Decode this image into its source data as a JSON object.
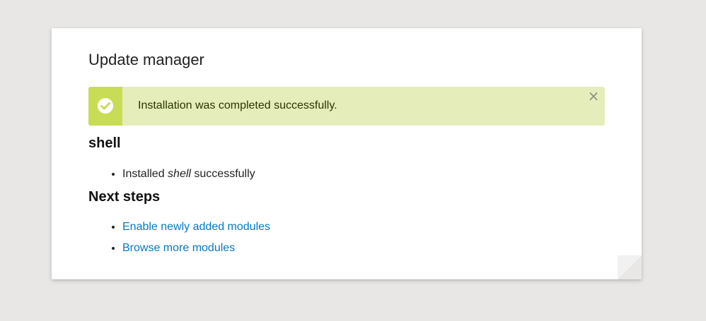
{
  "page": {
    "title": "Update manager"
  },
  "status": {
    "message": "Installation was completed successfully.",
    "dismiss_glyph": "×"
  },
  "module": {
    "name": "shell",
    "result": {
      "prefix": "Installed ",
      "name": "shell",
      "suffix": " successfully"
    }
  },
  "next_steps": {
    "heading": "Next steps",
    "links": [
      {
        "label": "Enable newly added modules"
      },
      {
        "label": "Browse more modules"
      }
    ]
  },
  "colors": {
    "background": "#e8e7e5",
    "status_bg": "#e5eebb",
    "status_accent": "#c9dc56",
    "link": "#0678be"
  },
  "icons": {
    "status": "check-circle-icon",
    "dismiss": "close-icon"
  }
}
